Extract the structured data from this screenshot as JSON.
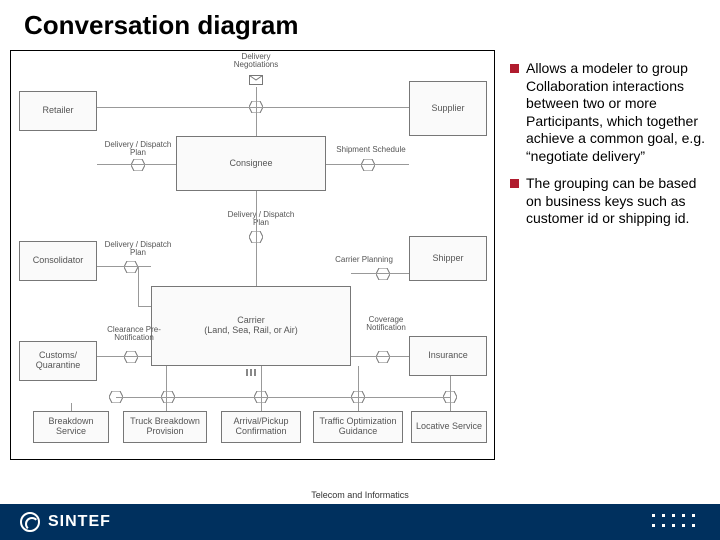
{
  "title": "Conversation diagram",
  "bullets": {
    "b1": "Allows a modeler to group Collaboration interactions between two or more Participants, which together achieve a common goal, e.g. “negotiate delivery”",
    "b2": "The grouping can be based on business keys such as customer id or shipping id."
  },
  "nodes": {
    "retailer": "Retailer",
    "consignee": "Consignee",
    "supplier": "Supplier",
    "consolidator": "Consolidator",
    "shipper": "Shipper",
    "carrier": "Carrier\n(Land, Sea, Rail, or Air)",
    "customs": "Customs/\nQuarantine",
    "insurance": "Insurance",
    "breakdown": "Breakdown\nService",
    "truckbreak": "Truck Breakdown\nProvision",
    "arrival": "Arrival/Pickup\nConfirmation",
    "traffic": "Traffic Optimization\nGuidance",
    "locative": "Locative Service"
  },
  "messages": {
    "delivNeg": "Delivery\nNegotiations",
    "delivDisp1": "Delivery / Dispatch\nPlan",
    "shipSched": "Shipment Schedule",
    "delivPlan": "Delivery / Dispatch\nPlan",
    "delivDisp2": "Delivery / Dispatch\nPlan",
    "carrierPlan": "Carrier Planning",
    "clearance": "Clearance Pre-\nNotification",
    "coverage": "Coverage\nNotification"
  },
  "footer": {
    "brand": "SINTEF",
    "center": "Telecom and Informatics"
  }
}
